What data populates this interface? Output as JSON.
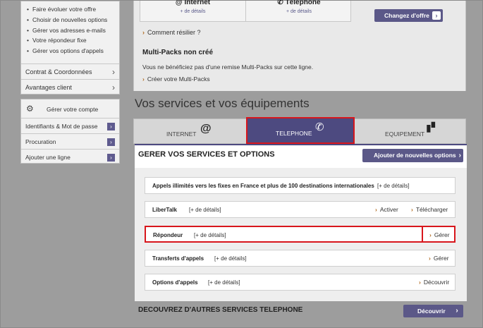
{
  "sidebar": {
    "menu_items": [
      "Faire évoluer votre offre",
      "Choisir de nouvelles options",
      "Gérer vos adresses e-mails",
      "Votre répondeur fixe",
      "Gérer vos options d'appels"
    ],
    "contrat_label": "Contrat & Coordonnées",
    "avantages_label": "Avantages client",
    "account_title": "Gérer votre compte",
    "account_items": [
      "Identifiants & Mot de passe",
      "Procuration",
      "Ajouter une ligne"
    ]
  },
  "top": {
    "col1_title": "Internet",
    "col1_details": "+ de détails",
    "col2_title": "Téléphone",
    "col2_details": "+ de détails",
    "change_offer_label": "Changez d'offre",
    "resilier_label": "Comment résilier ?",
    "multipacks_title": "Multi-Packs non créé",
    "multipacks_text": "Vous ne bénéficiez pas d'une remise Multi-Packs sur cette ligne.",
    "multipacks_link": "Créer votre Multi-Packs"
  },
  "section_title": "Vos services et vos équipements",
  "tabs": {
    "internet": "INTERNET",
    "telephone": "TELEPHONE",
    "equipement": "EQUIPEMENT"
  },
  "services": {
    "title": "GERER VOS SERVICES ET OPTIONS",
    "add_button": "Ajouter de nouvelles options",
    "rows": [
      {
        "name": "Appels illimités vers les fixes en France et plus de 100 destinations internationales",
        "details": "[+ de détails]"
      },
      {
        "name": "LiberTalk",
        "details": "[+ de détails]",
        "action1": "Activer",
        "action2": "Télécharger"
      },
      {
        "name": "Répondeur",
        "details": "[+ de détails]",
        "action1": "Gérer"
      },
      {
        "name": "Transferts d'appels",
        "details": "[+ de détails]",
        "action1": "Gérer"
      },
      {
        "name": "Options d'appels",
        "details": "[+ de détails]",
        "action1": "Découvrir"
      }
    ]
  },
  "discover": {
    "title": "DECOUVREZ D'AUTRES SERVICES TELEPHONE",
    "button": "Découvrir"
  },
  "colors": {
    "overlay": "#9d9d9d",
    "brand_purple": "#5b5888",
    "highlight_red": "#d8161c",
    "link_chevron": "#b06a20"
  }
}
